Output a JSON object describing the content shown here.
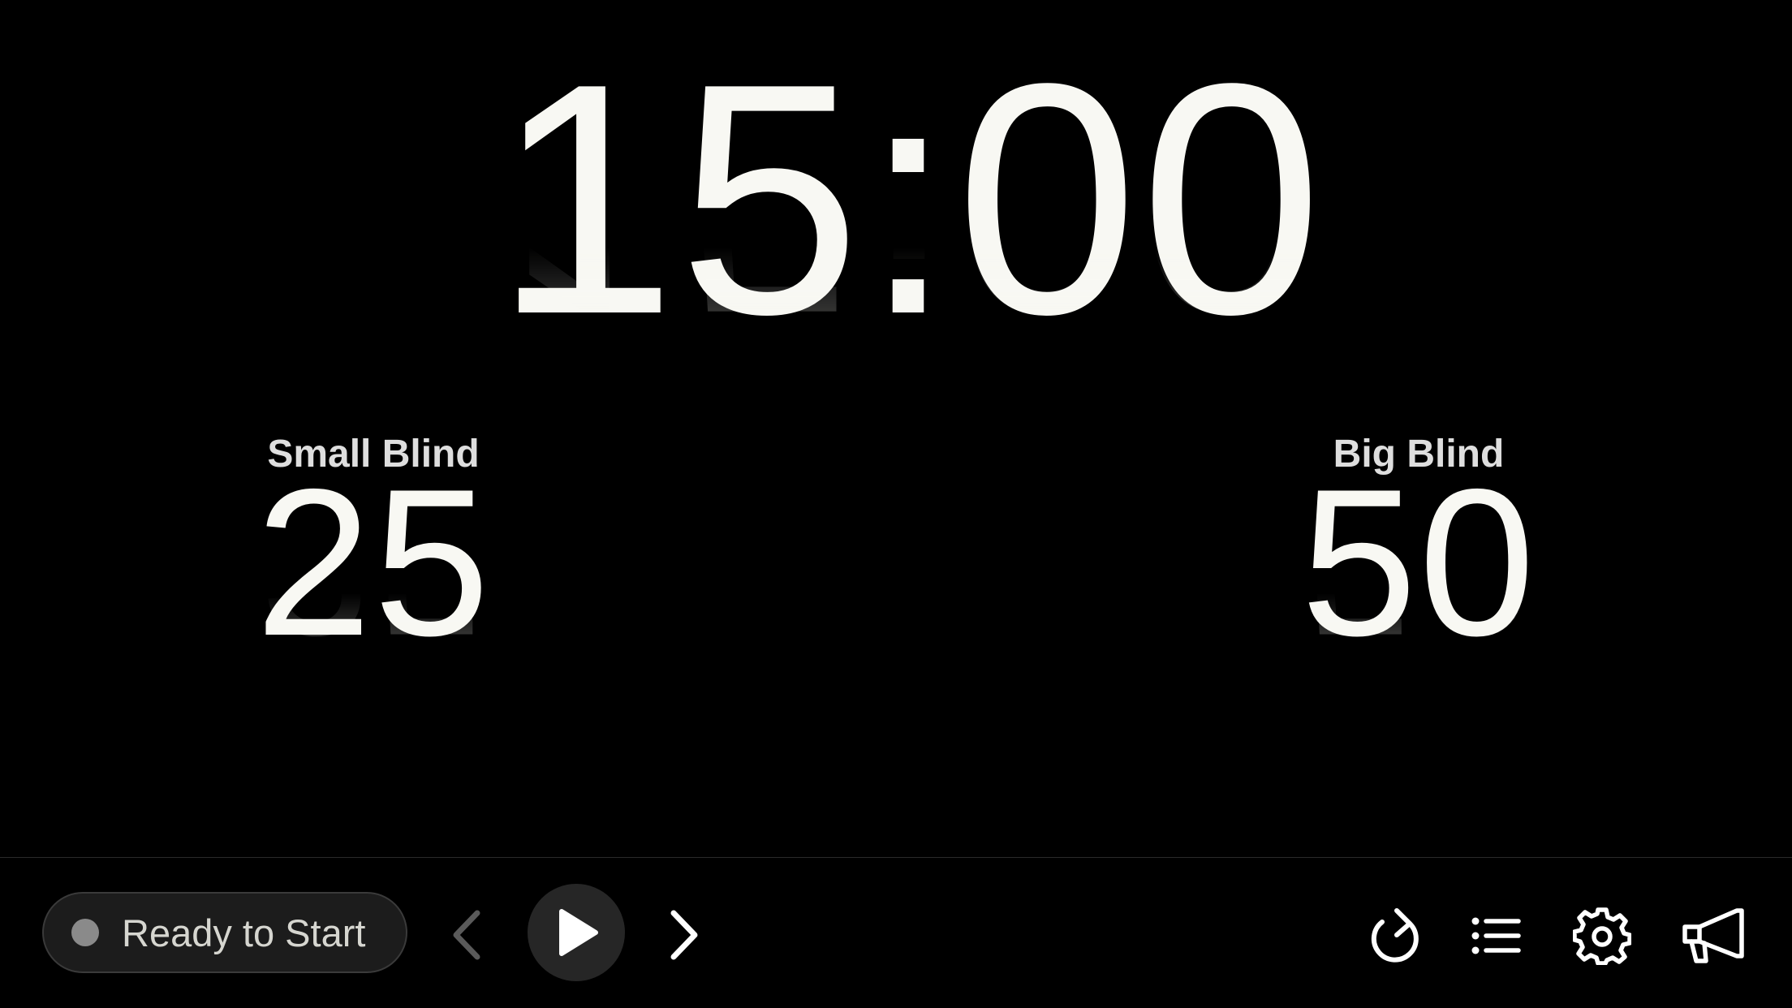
{
  "timer": {
    "time": "15:00"
  },
  "small_blind": {
    "label": "Small Blind",
    "value": "25"
  },
  "big_blind": {
    "label": "Big Blind",
    "value": "50"
  },
  "toolbar": {
    "status_text": "Ready to Start",
    "status_color": "#8a8a8a",
    "icons": [
      "chevron-left-icon",
      "play-icon",
      "chevron-right-icon",
      "reset-icon",
      "list-icon",
      "gear-icon",
      "megaphone-icon"
    ]
  },
  "colors": {
    "background": "#000000",
    "text": "#f8f8f3",
    "label": "#dedede"
  }
}
